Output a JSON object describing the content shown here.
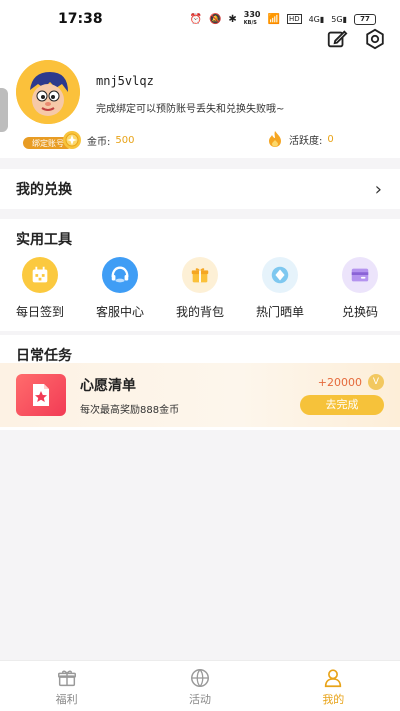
{
  "status": {
    "time": "17:38",
    "speed": "330",
    "speed_unit": "KB/S",
    "battery": "77",
    "network1": "4G",
    "network2": "5G"
  },
  "profile": {
    "username": "mnj5vlqz",
    "avatar_badge": "绑定账号",
    "bind_tip": "完成绑定可以预防账号丢失和兑换失败哦~",
    "coins_label": "金币:",
    "coins_value": "500",
    "activity_label": "活跃度:",
    "activity_value": "0"
  },
  "exchange": {
    "label": "我的兑换"
  },
  "tools": {
    "title": "实用工具",
    "items": [
      {
        "label": "每日签到",
        "icon": "calendar-icon"
      },
      {
        "label": "客服中心",
        "icon": "headset-icon"
      },
      {
        "label": "我的背包",
        "icon": "gift-icon"
      },
      {
        "label": "热门晒单",
        "icon": "diamond-icon"
      },
      {
        "label": "兑换码",
        "icon": "card-icon"
      }
    ]
  },
  "tasks": {
    "title": "日常任务",
    "items": [
      {
        "title": "心愿清单",
        "desc": "每次最高奖励888金币",
        "reward": "+20000",
        "coin": "V",
        "button": "去完成"
      }
    ]
  },
  "tabbar": {
    "items": [
      {
        "label": "福利",
        "icon": "gift-tab-icon"
      },
      {
        "label": "活动",
        "icon": "ball-tab-icon"
      },
      {
        "label": "我的",
        "icon": "person-tab-icon"
      }
    ],
    "active": "我的"
  },
  "colors": {
    "accent": "#e8a318",
    "button": "#f6c23a",
    "reward": "#e56a3c"
  }
}
